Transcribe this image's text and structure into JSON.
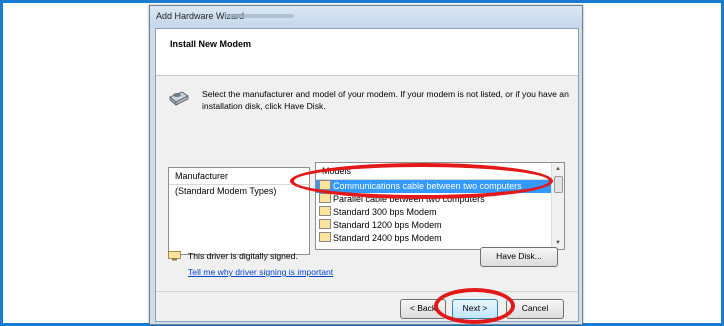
{
  "window": {
    "title": "Add Hardware Wizard"
  },
  "header": {
    "title": "Install New Modem"
  },
  "instructions": "Select the manufacturer and model of your modem. If your modem is not listed, or if you have an installation disk, click Have Disk.",
  "manufacturer": {
    "header": "Manufacturer",
    "items": [
      "(Standard Modem Types)"
    ]
  },
  "models": {
    "header": "Models",
    "items": [
      "Communications cable between two computers",
      "Parallel cable between two computers",
      "Standard  300 bps Modem",
      "Standard  1200 bps Modem",
      "Standard  2400 bps Modem"
    ],
    "selected_index": 0
  },
  "driver": {
    "signed_text": "This driver is digitally signed.",
    "link_text": "Tell me why driver signing is important"
  },
  "buttons": {
    "have_disk": "Have Disk...",
    "back": "< Back",
    "next": "Next >",
    "cancel": "Cancel"
  },
  "colors": {
    "frame_border": "#1a7bd0",
    "annotation": "#e31818",
    "selection": "#3399ff"
  }
}
